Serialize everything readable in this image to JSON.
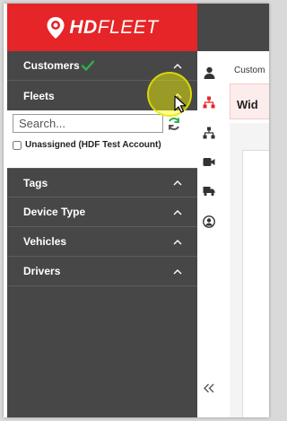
{
  "brand": {
    "logo_text_bold": "HD",
    "logo_text_thin": "FLEET",
    "color": "#e52527"
  },
  "sidebar": {
    "customers_label": "Customers",
    "fleets_label": "Fleets",
    "search": {
      "placeholder": "Search...",
      "value": ""
    },
    "fleet_items": [
      {
        "label": "Unassigned (HDF Test Account)",
        "checked": false
      }
    ],
    "sections": [
      {
        "label": "Tags"
      },
      {
        "label": "Device Type"
      },
      {
        "label": "Vehicles"
      },
      {
        "label": "Drivers"
      }
    ]
  },
  "rail": {
    "icons": [
      "user-icon",
      "org-chart-icon",
      "hierarchy-icon",
      "video-camera-icon",
      "truck-icon",
      "user-circle-icon"
    ]
  },
  "main": {
    "breadcrumb": "Custom",
    "widget_title": "Wid"
  },
  "colors": {
    "sidebar_bg": "#474747",
    "accent_red": "#e52527",
    "check_green": "#2bb24c"
  }
}
